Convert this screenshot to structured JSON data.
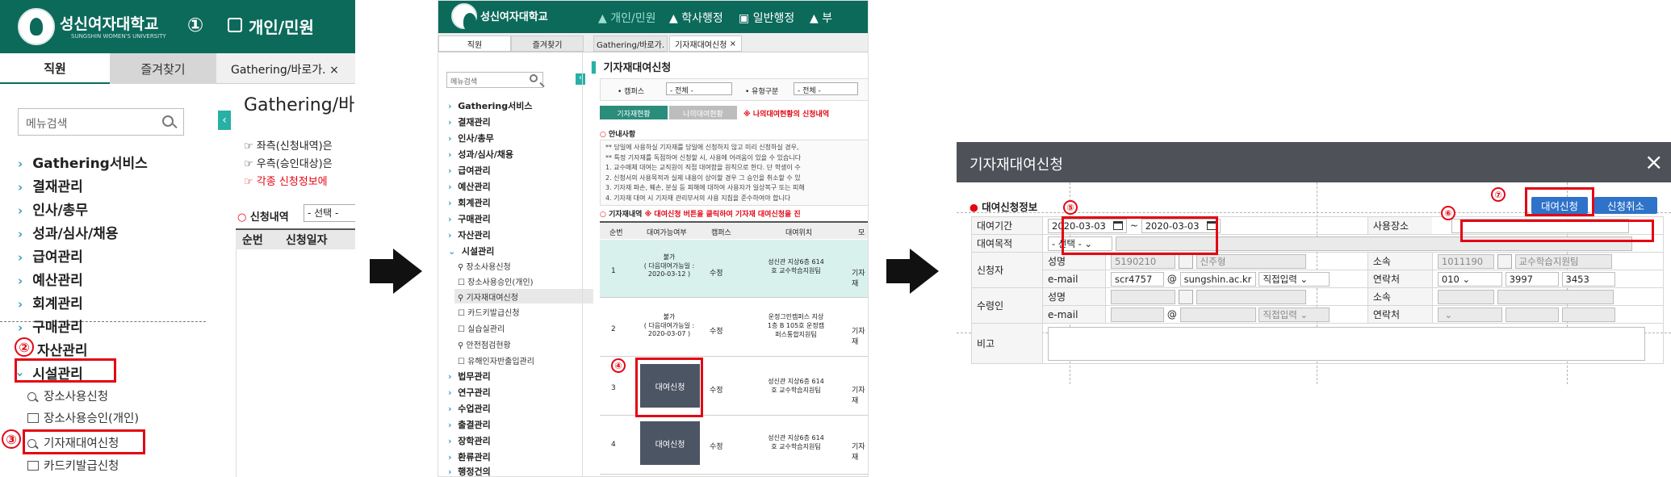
{
  "panel1": {
    "uni_name": "성신여자대학교",
    "uni_sub": "SUNGSHIN WOMEN'S UNIVERSITY",
    "nav_label": "개인/민원",
    "step1": "①",
    "tab_staff": "직원",
    "tab_fav": "즐겨찾기",
    "tab_open": "Gathering/바로가.",
    "tab_close": "×",
    "content_title": "Gathering/바",
    "search_placeholder": "메뉴검색",
    "notes": [
      "☞ 좌측(신청내역)은",
      "☞ 우측(승인대상)은",
      "☞ 각종 신청정보에"
    ],
    "apply_list_label": "신청내역",
    "apply_select": "- 선택 -",
    "col_no": "순번",
    "col_date": "신청일자",
    "menu": [
      "Gathering서비스",
      "결재관리",
      "인사/총무",
      "성과/심사/채용",
      "급여관리",
      "예산관리",
      "회계관리",
      "구매관리",
      "자산관리",
      "시설관리"
    ],
    "submenu": [
      "장소사용신청",
      "장소사용승인(개인)",
      "기자재대여신청",
      "카드키발급신청"
    ],
    "step2": "②",
    "step3": "③"
  },
  "panel2": {
    "uni_name": "성신여자대학교",
    "nav": [
      "개인/민원",
      "학사행정",
      "일반행정",
      "부"
    ],
    "tabs": [
      "직원",
      "즐겨찾기",
      "Gathering/바로가.",
      "기자재대여신청",
      "×"
    ],
    "search_placeholder": "메뉴검색",
    "menu_top": [
      "Gathering서비스",
      "결재관리",
      "인사/총무",
      "성과/심사/채용",
      "급여관리",
      "예산관리",
      "회계관리",
      "구매관리",
      "자산관리",
      "시설관리"
    ],
    "menu_sub": [
      "장소사용신청",
      "장소사용승인(개인)",
      "기자재대여신청",
      "카드키발급신청",
      "실습실관리",
      "안전점검현황",
      "유해인자반출입관리"
    ],
    "menu_bottom": [
      "법무관리",
      "연구관리",
      "수업관리",
      "출결관리",
      "장학관리",
      "환류관리",
      "행정건의"
    ],
    "page_title": "기자재대여신청",
    "filter_campus": "• 캠퍼스",
    "filter_all1": "- 전체 -",
    "filter_type": "• 유형구분",
    "filter_all2": "- 전체 -",
    "subtab_active": "기자재현황",
    "subtab_other": "나의대여현황",
    "notice_red": "※ 나의대여현황의 신청내역",
    "guide_title": "안내사항",
    "guide_lines": [
      "** 당일에 사용하실 기자재를 당일에 신청하지 않고 미리 신청하실 경우,",
      "** 특정 기자재를 독점하여 신청할 시, 사용에 어려움이 있을 수 있습니다",
      "1. 교수매체 대여는 교직원이 직접 대여함을 원칙으로 한다. 단 학생이 수",
      "2. 신청서의 사용목적과 실제 내용이 상이할 경우 그 승인을 취소할 수 있",
      "3. 기자재 파손, 훼손, 분실 등 피해에 대하여 사용자가 일상복구 또는 피해",
      "4. 기자재 대여 시 기자재 관리부서의 사용 지침을 준수하여야 합니다"
    ],
    "list_label": "기자재내역",
    "list_notice": "※ 대여신청 버튼을 클릭하여 기자재 대여신청을 진",
    "table_headers": [
      "순번",
      "대여가능여부",
      "캠퍼스",
      "대여위치",
      "모"
    ],
    "rows": [
      {
        "no": "1",
        "status": "불가\n( 다음대여가능일 :\n2020-03-12 )",
        "campus": "수정",
        "loc": "성신관 지상6층 614\n호 교수학습지원팀",
        "model": "기자재"
      },
      {
        "no": "2",
        "status": "불가\n( 다음대여가능일 :\n2020-03-07 )",
        "campus": "수정",
        "loc": "운정그린캠퍼스 지상\n1층 B 105호 운정캠\n퍼스통합지원팀",
        "model": "기자재"
      },
      {
        "no": "3",
        "status": "대여신청",
        "campus": "수정",
        "loc": "성신관 지상6층 614\n호 교수학습지원팀",
        "model": "기자재"
      },
      {
        "no": "4",
        "status": "대여신청",
        "campus": "수정",
        "loc": "성신관 지상6층 614\n호 교수학습지원팀",
        "model": "기자재"
      }
    ],
    "step4": "④"
  },
  "panel3": {
    "title": "기자재대여신청",
    "close": "×",
    "section": "대여신청정보",
    "btn_apply": "대여신청",
    "btn_cancel": "신청취소",
    "step5": "⑤",
    "step6": "⑥",
    "step7": "⑦",
    "lbl_period": "대여기간",
    "date_from": "2020-03-03",
    "tilde": "~",
    "date_to": "2020-03-03",
    "lbl_place": "사용장소",
    "lbl_purpose": "대여목적",
    "purpose_select": "- 선택 -",
    "lbl_applicant": "신청자",
    "lbl_name": "성명",
    "name_id": "5190210",
    "name_val": "신주형",
    "lbl_dept": "소속",
    "dept_code": "1011190",
    "dept_val": "교수학습지원팀",
    "lbl_email": "e-mail",
    "email_id": "scr4757",
    "at": "@",
    "email_domain": "sungshin.ac.kr",
    "email_direct": "직접입력",
    "lbl_phone": "연락처",
    "phone1": "010",
    "phone2": "3997",
    "phone3": "3453",
    "lbl_receiver": "수령인",
    "lbl_name2": "성명",
    "lbl_dept2": "소속",
    "lbl_email2": "e-mail",
    "at2": "@",
    "email_direct2": "직접입력",
    "lbl_phone2": "연락처",
    "lbl_note": "비고"
  }
}
